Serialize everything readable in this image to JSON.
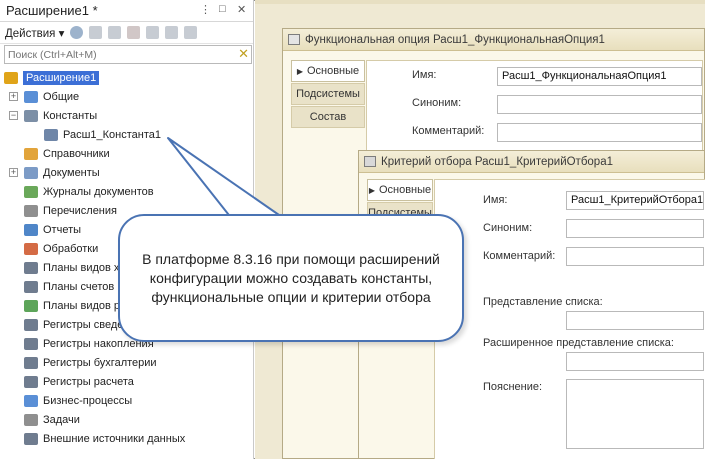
{
  "left_panel": {
    "title": "Расширение1 *",
    "title_controls": [
      "⋮",
      "□",
      "✕"
    ],
    "actions_label": "Действия",
    "search_placeholder": "Поиск (Ctrl+Alt+M)",
    "search_clear": "✕",
    "tree": [
      {
        "label": "Расширение1",
        "icon": "extension-icon",
        "color": "#e0a419",
        "level": 0,
        "toggle": "",
        "selected": true
      },
      {
        "label": "Общие",
        "icon": "common-icon",
        "color": "#5a8fd6",
        "level": 1,
        "toggle": "+"
      },
      {
        "label": "Константы",
        "icon": "constants-icon",
        "color": "#7c8fa6",
        "level": 1,
        "toggle": "−"
      },
      {
        "label": "Расш1_Константа1",
        "icon": "constant-icon",
        "color": "#6f86a8",
        "level": 2,
        "toggle": ""
      },
      {
        "label": "Справочники",
        "icon": "catalogs-icon",
        "color": "#e2a43b",
        "level": 1,
        "toggle": ""
      },
      {
        "label": "Документы",
        "icon": "documents-icon",
        "color": "#7c9bc6",
        "level": 1,
        "toggle": "+"
      },
      {
        "label": "Журналы документов",
        "icon": "journals-icon",
        "color": "#6aa85a",
        "level": 1,
        "toggle": ""
      },
      {
        "label": "Перечисления",
        "icon": "enums-icon",
        "color": "#8f8f8f",
        "level": 1,
        "toggle": ""
      },
      {
        "label": "Отчеты",
        "icon": "reports-icon",
        "color": "#4f86c8",
        "level": 1,
        "toggle": ""
      },
      {
        "label": "Обработки",
        "icon": "dataprocessors-icon",
        "color": "#d46b45",
        "level": 1,
        "toggle": ""
      },
      {
        "label": "Планы видов характеристик",
        "icon": "chart-of-characteristics-icon",
        "color": "#6f7c8f",
        "level": 1,
        "toggle": ""
      },
      {
        "label": "Планы счетов",
        "icon": "charts-of-accounts-icon",
        "color": "#6f7c8f",
        "level": 1,
        "toggle": ""
      },
      {
        "label": "Планы видов расчета",
        "icon": "chart-of-calculation-icon",
        "color": "#5da55a",
        "level": 1,
        "toggle": ""
      },
      {
        "label": "Регистры сведений",
        "icon": "info-registers-icon",
        "color": "#6f7c8f",
        "level": 1,
        "toggle": ""
      },
      {
        "label": "Регистры накопления",
        "icon": "accumulation-registers-icon",
        "color": "#6f7c8f",
        "level": 1,
        "toggle": ""
      },
      {
        "label": "Регистры бухгалтерии",
        "icon": "accounting-registers-icon",
        "color": "#6f7c8f",
        "level": 1,
        "toggle": ""
      },
      {
        "label": "Регистры расчета",
        "icon": "calculation-registers-icon",
        "color": "#6f7c8f",
        "level": 1,
        "toggle": ""
      },
      {
        "label": "Бизнес-процессы",
        "icon": "business-processes-icon",
        "color": "#5a8fd6",
        "level": 1,
        "toggle": ""
      },
      {
        "label": "Задачи",
        "icon": "tasks-icon",
        "color": "#8f8f8f",
        "level": 1,
        "toggle": ""
      },
      {
        "label": "Внешние источники данных",
        "icon": "external-sources-icon",
        "color": "#6f7c8f",
        "level": 1,
        "toggle": ""
      }
    ]
  },
  "window1": {
    "title": "Функциональная опция Расш1_ФункциональнаяОпция1",
    "tabs": [
      "Основные",
      "Подсистемы",
      "Состав"
    ],
    "fields": {
      "name_label": "Имя:",
      "name_value": "Расш1_ФункциональнаяОпция1",
      "synonym_label": "Синоним:",
      "comment_label": "Комментарий:"
    }
  },
  "window2": {
    "title": "Критерий отбора Расш1_КритерийОтбора1",
    "tabs": [
      "Основные",
      "Подсистемы"
    ],
    "fields": {
      "name_label": "Имя:",
      "name_value": "Расш1_КритерийОтбора1",
      "synonym_label": "Синоним:",
      "comment_label": "Комментарий:",
      "list_presentation_label": "Представление списка:",
      "ext_list_presentation_label": "Расширенное представление списка:",
      "explanation_label": "Пояснение:"
    }
  },
  "callout": {
    "text": "В платформе 8.3.16 при помощи расширений конфигурации можно создавать константы, функциональные опции и критерии отбора"
  },
  "colors": {
    "selection": "#3c6fd6",
    "callout_border": "#4a73b3",
    "window_bg": "#fbf8ea",
    "workarea_bg": "#efe9d3"
  }
}
